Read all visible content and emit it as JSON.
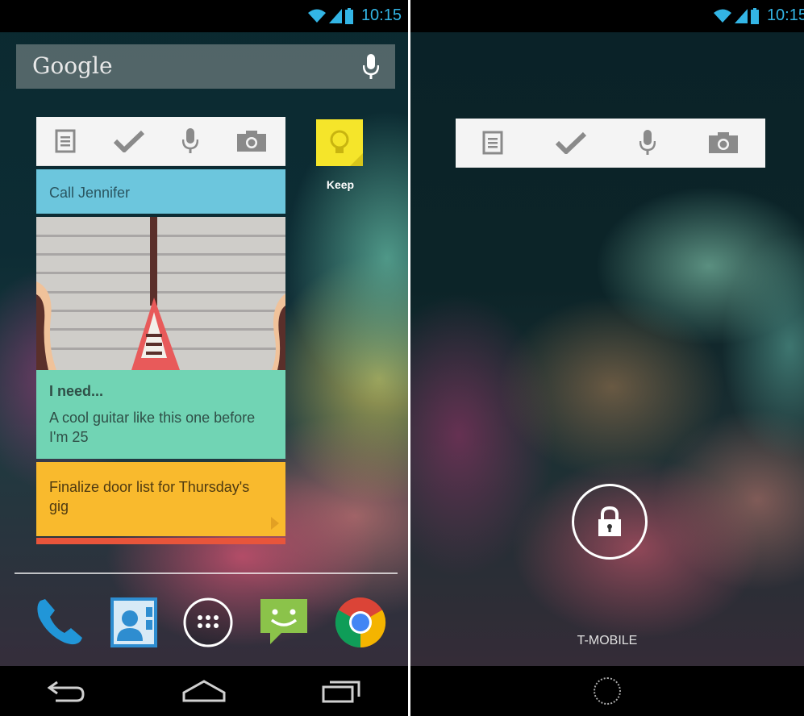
{
  "statusbar": {
    "time": "10:15"
  },
  "search": {
    "logo": "Google",
    "mic_icon": "mic-icon"
  },
  "keep_widget": {
    "toolbar": [
      "note-icon",
      "checkmark-icon",
      "mic-icon",
      "camera-icon"
    ],
    "notes": [
      {
        "text": "Call Jennifer",
        "color": "#6cc6dd"
      },
      {
        "title": "I need...",
        "text": "A cool guitar like this one before I'm 25",
        "color": "#71d4b4"
      },
      {
        "text": "Finalize door list for Thursday's gig",
        "color": "#f9ba2d"
      }
    ]
  },
  "apps": {
    "keep_label": "Keep"
  },
  "dock": [
    "phone-icon",
    "contacts-icon",
    "app-drawer-icon",
    "messaging-icon",
    "chrome-icon"
  ],
  "navbar": [
    "back-icon",
    "home-icon",
    "recents-icon"
  ],
  "lockscreen": {
    "carrier": "T-MOBILE",
    "lock_icon": "lock-icon"
  }
}
